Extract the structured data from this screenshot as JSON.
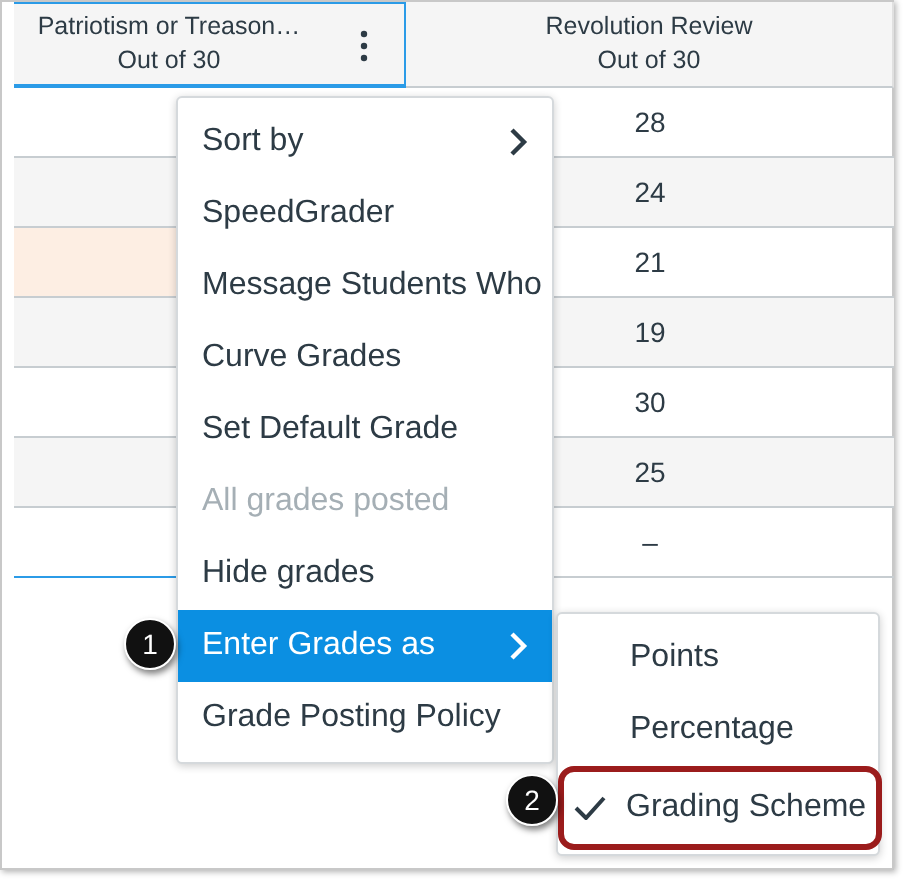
{
  "table": {
    "columns": [
      {
        "title": "Patriotism or Treason…",
        "subtitle": "Out of 30",
        "selected": true
      },
      {
        "title": "Revolution Review",
        "subtitle": "Out of 30",
        "selected": false
      }
    ],
    "rows": [
      {
        "column_2": "28",
        "flagged": false
      },
      {
        "column_2": "24",
        "flagged": false
      },
      {
        "column_2": "21",
        "flagged": true
      },
      {
        "column_2": "19",
        "flagged": false
      },
      {
        "column_2": "30",
        "flagged": false
      },
      {
        "column_2": "25",
        "flagged": false
      },
      {
        "column_2": "–",
        "flagged": false
      }
    ]
  },
  "menu": {
    "items": [
      {
        "label": "Sort by",
        "kind": "submenu",
        "disabled": false,
        "selected": false
      },
      {
        "label": "SpeedGrader",
        "kind": "item",
        "disabled": false,
        "selected": false
      },
      {
        "label": "Message Students Who",
        "kind": "item",
        "disabled": false,
        "selected": false
      },
      {
        "label": "Curve Grades",
        "kind": "item",
        "disabled": false,
        "selected": false
      },
      {
        "label": "Set Default Grade",
        "kind": "item",
        "disabled": false,
        "selected": false
      },
      {
        "label": "All grades posted",
        "kind": "item",
        "disabled": true,
        "selected": false
      },
      {
        "label": "Hide grades",
        "kind": "item",
        "disabled": false,
        "selected": false
      },
      {
        "label": "Enter Grades as",
        "kind": "submenu",
        "disabled": false,
        "selected": true
      },
      {
        "label": "Grade Posting Policy",
        "kind": "item",
        "disabled": false,
        "selected": false
      }
    ]
  },
  "submenu": {
    "items": [
      {
        "label": "Points",
        "checked": false
      },
      {
        "label": "Percentage",
        "checked": false
      },
      {
        "label": "Grading Scheme",
        "checked": true
      }
    ]
  },
  "callouts": [
    {
      "number": "1"
    },
    {
      "number": "2"
    }
  ]
}
